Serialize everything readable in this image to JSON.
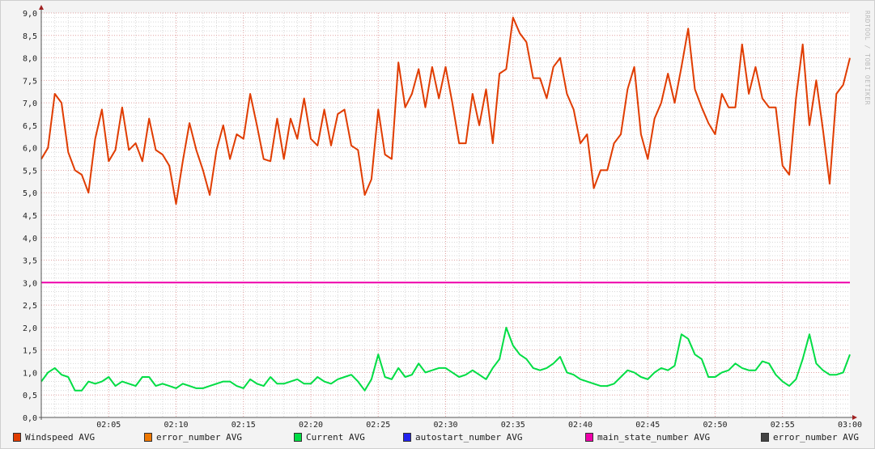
{
  "chart_data": {
    "type": "line",
    "title": "",
    "xlabel": "",
    "ylabel": "",
    "watermark": "RRDTOOL / TOBI OETIKER",
    "xlim_minutes": [
      0,
      60
    ],
    "ylim": [
      0,
      9
    ],
    "grid": true,
    "legend_placement": "bottom",
    "x_ticks": [
      {
        "min": 5,
        "label": "02:05"
      },
      {
        "min": 10,
        "label": "02:10"
      },
      {
        "min": 15,
        "label": "02:15"
      },
      {
        "min": 20,
        "label": "02:20"
      },
      {
        "min": 25,
        "label": "02:25"
      },
      {
        "min": 30,
        "label": "02:30"
      },
      {
        "min": 35,
        "label": "02:35"
      },
      {
        "min": 40,
        "label": "02:40"
      },
      {
        "min": 45,
        "label": "02:45"
      },
      {
        "min": 50,
        "label": "02:50"
      },
      {
        "min": 55,
        "label": "02:55"
      },
      {
        "min": 60,
        "label": "03:00"
      }
    ],
    "y_ticks": [
      {
        "v": 0,
        "label": "0,0"
      },
      {
        "v": 0.5,
        "label": "0,5"
      },
      {
        "v": 1,
        "label": "1,0"
      },
      {
        "v": 1.5,
        "label": "1,5"
      },
      {
        "v": 2,
        "label": "2,0"
      },
      {
        "v": 2.5,
        "label": "2,5"
      },
      {
        "v": 3,
        "label": "3,0"
      },
      {
        "v": 3.5,
        "label": "3,5"
      },
      {
        "v": 4,
        "label": "4,0"
      },
      {
        "v": 4.5,
        "label": "4,5"
      },
      {
        "v": 5,
        "label": "5,0"
      },
      {
        "v": 5.5,
        "label": "5,5"
      },
      {
        "v": 6,
        "label": "6,0"
      },
      {
        "v": 6.5,
        "label": "6,5"
      },
      {
        "v": 7,
        "label": "7,0"
      },
      {
        "v": 7.5,
        "label": "7,5"
      },
      {
        "v": 8,
        "label": "8,0"
      },
      {
        "v": 8.5,
        "label": "8,5"
      },
      {
        "v": 9,
        "label": "9,0"
      }
    ],
    "series": [
      {
        "name": "Windspeed AVG",
        "color": "#E03C00",
        "x_step_minutes": 0.5,
        "values": [
          5.75,
          6.0,
          7.2,
          7.0,
          5.9,
          5.5,
          5.4,
          5.0,
          6.2,
          6.85,
          5.7,
          5.95,
          6.9,
          5.95,
          6.1,
          5.7,
          6.65,
          5.95,
          5.85,
          5.6,
          4.75,
          5.7,
          6.55,
          5.95,
          5.5,
          4.95,
          5.95,
          6.5,
          5.75,
          6.3,
          6.2,
          7.2,
          6.5,
          5.75,
          5.7,
          6.65,
          5.75,
          6.65,
          6.2,
          7.1,
          6.2,
          6.05,
          6.85,
          6.05,
          6.75,
          6.85,
          6.05,
          5.95,
          4.95,
          5.3,
          6.85,
          5.85,
          5.75,
          7.9,
          6.9,
          7.2,
          7.75,
          6.9,
          7.8,
          7.1,
          7.8,
          7.0,
          6.1,
          6.1,
          7.2,
          6.5,
          7.3,
          6.1,
          7.65,
          7.75,
          8.9,
          8.55,
          8.35,
          7.55,
          7.55,
          7.1,
          7.8,
          8.0,
          7.2,
          6.85,
          6.1,
          6.3,
          5.1,
          5.5,
          5.5,
          6.1,
          6.3,
          7.3,
          7.8,
          6.3,
          5.75,
          6.65,
          7.0,
          7.65,
          7.0,
          7.8,
          8.65,
          7.3,
          6.9,
          6.55,
          6.3,
          7.2,
          6.9,
          6.9,
          8.3,
          7.2,
          7.8,
          7.1,
          6.9,
          6.9,
          5.6,
          5.4,
          7.1,
          8.3,
          6.5,
          7.5,
          6.4,
          5.2,
          7.2,
          7.4,
          8.0
        ]
      },
      {
        "name": "error_number AVG",
        "color": "#EE7700",
        "values": []
      },
      {
        "name": "Current AVG",
        "color": "#00DD44",
        "x_step_minutes": 0.5,
        "values": [
          0.8,
          1.0,
          1.1,
          0.95,
          0.9,
          0.6,
          0.6,
          0.8,
          0.75,
          0.8,
          0.9,
          0.7,
          0.8,
          0.75,
          0.7,
          0.9,
          0.9,
          0.7,
          0.75,
          0.7,
          0.65,
          0.75,
          0.7,
          0.65,
          0.65,
          0.7,
          0.75,
          0.8,
          0.8,
          0.7,
          0.65,
          0.85,
          0.75,
          0.7,
          0.9,
          0.75,
          0.75,
          0.8,
          0.85,
          0.75,
          0.75,
          0.9,
          0.8,
          0.75,
          0.85,
          0.9,
          0.95,
          0.8,
          0.6,
          0.85,
          1.4,
          0.9,
          0.85,
          1.1,
          0.9,
          0.95,
          1.2,
          1.0,
          1.05,
          1.1,
          1.1,
          1.0,
          0.9,
          0.95,
          1.05,
          0.95,
          0.85,
          1.1,
          1.3,
          2.0,
          1.6,
          1.4,
          1.3,
          1.1,
          1.05,
          1.1,
          1.2,
          1.35,
          1.0,
          0.95,
          0.85,
          0.8,
          0.75,
          0.7,
          0.7,
          0.75,
          0.9,
          1.05,
          1.0,
          0.9,
          0.85,
          1.0,
          1.1,
          1.05,
          1.15,
          1.85,
          1.75,
          1.4,
          1.3,
          0.9,
          0.9,
          1.0,
          1.05,
          1.2,
          1.1,
          1.05,
          1.05,
          1.25,
          1.2,
          0.95,
          0.8,
          0.7,
          0.85,
          1.3,
          1.85,
          1.2,
          1.05,
          0.95,
          0.95,
          1.0,
          1.4
        ]
      },
      {
        "name": "autostart_number AVG",
        "color": "#2222EE",
        "values": []
      },
      {
        "name": "main_state_number AVG",
        "color": "#EE00AA",
        "x_step_minutes": 60,
        "values": [
          3.0,
          3.0
        ]
      },
      {
        "name": "error_number AVG",
        "color": "#444444",
        "values": []
      }
    ]
  }
}
